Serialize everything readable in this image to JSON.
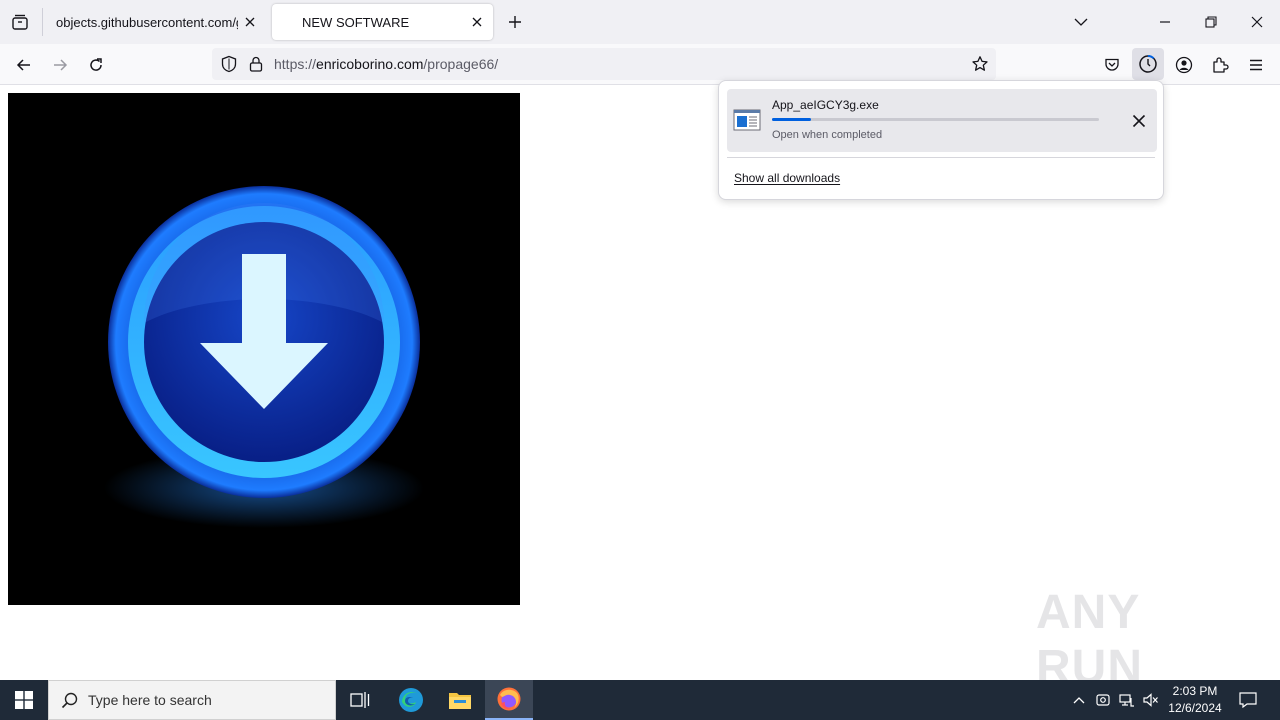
{
  "browser": {
    "tabs": [
      {
        "title": "objects.githubusercontent.com/gith",
        "active": false
      },
      {
        "title": "NEW SOFTWARE",
        "active": true
      }
    ],
    "url_prefix": "https://",
    "url_domain": "enricoborino.com",
    "url_path": "/propage66/"
  },
  "downloads_panel": {
    "item": {
      "filename": "App_aeIGCY3g.exe",
      "status": "Open when completed",
      "progress": 0.12
    },
    "show_all_label": "Show all downloads"
  },
  "watermark": {
    "text": "ANY RUN"
  },
  "taskbar": {
    "search_placeholder": "Type here to search",
    "time": "2:03 PM",
    "date": "12/6/2024"
  },
  "colors": {
    "accent": "#0060df",
    "taskbar_bg": "#1f2a38",
    "tabstrip_bg": "#f0f0f4",
    "hero_bg": "#000000"
  },
  "icons": [
    "tab-list-icon",
    "close-icon",
    "plus-icon",
    "chevron-down-icon",
    "minimize-icon",
    "restore-icon",
    "back-icon",
    "forward-icon",
    "reload-icon",
    "shield-icon",
    "lock-icon",
    "star-icon",
    "pocket-icon",
    "downloads-icon",
    "account-icon",
    "extensions-icon",
    "menu-icon",
    "file-icon",
    "windows-logo-icon",
    "search-icon",
    "task-view-icon",
    "edge-icon",
    "file-explorer-icon",
    "firefox-icon",
    "chevron-up-icon",
    "meet-icon",
    "network-icon",
    "volume-muted-icon",
    "notification-icon",
    "download-arrow-icon"
  ]
}
